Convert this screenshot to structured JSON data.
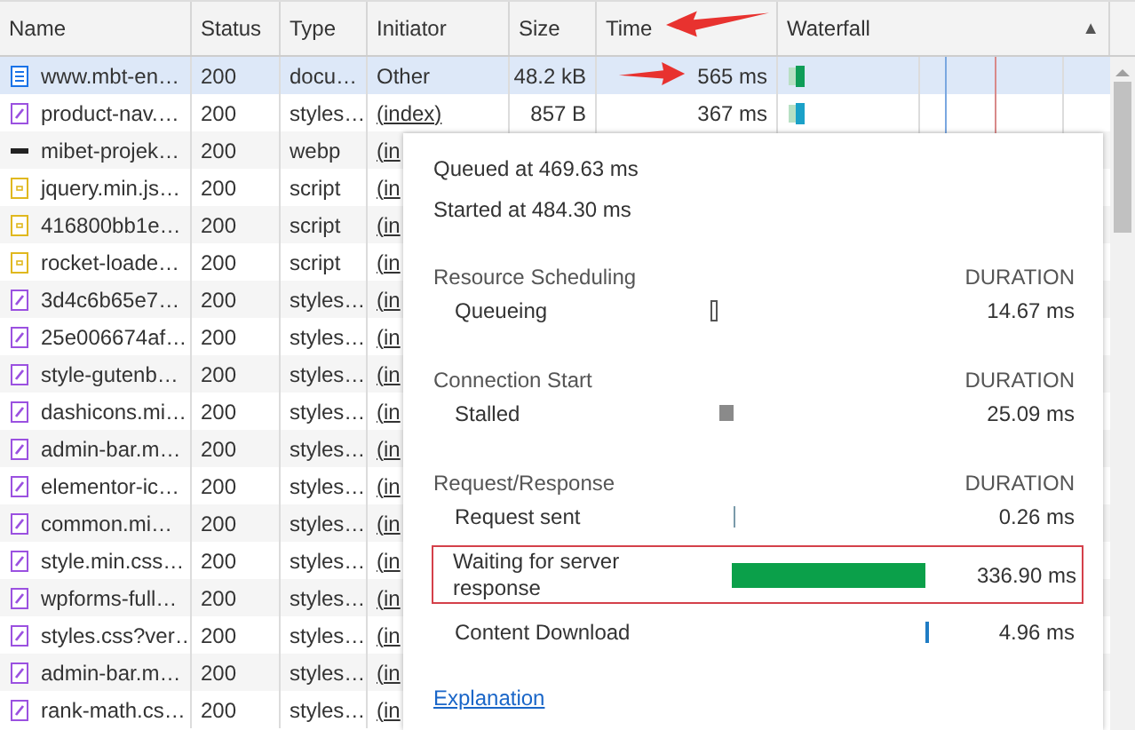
{
  "table": {
    "columns": [
      {
        "label": "Name"
      },
      {
        "label": "Status"
      },
      {
        "label": "Type"
      },
      {
        "label": "Initiator"
      },
      {
        "label": "Size"
      },
      {
        "label": "Time"
      },
      {
        "label": "Waterfall",
        "sort_indicator": "▲"
      }
    ],
    "rows": [
      {
        "kind": "doc",
        "name": "www.mbt-en…",
        "status": "200",
        "type": "docu…",
        "initiator": "Other",
        "initiator_link": false,
        "size": "48.2 kB",
        "time": "565 ms",
        "selected": true
      },
      {
        "kind": "css",
        "name": "product-nav.…",
        "status": "200",
        "type": "styles…",
        "initiator": "(index)",
        "initiator_link": true,
        "size": "857 B",
        "time": "367 ms",
        "selected": false
      },
      {
        "kind": "img",
        "name": "mibet-projek…",
        "status": "200",
        "type": "webp",
        "initiator": "(in",
        "initiator_link": true,
        "selected": false
      },
      {
        "kind": "js",
        "name": "jquery.min.js…",
        "status": "200",
        "type": "script",
        "initiator": "(in",
        "initiator_link": true,
        "selected": false
      },
      {
        "kind": "js",
        "name": "416800bb1e…",
        "status": "200",
        "type": "script",
        "initiator": "(in",
        "initiator_link": true,
        "selected": false
      },
      {
        "kind": "js",
        "name": "rocket-loade…",
        "status": "200",
        "type": "script",
        "initiator": "(in",
        "initiator_link": true,
        "selected": false
      },
      {
        "kind": "css",
        "name": "3d4c6b65e7…",
        "status": "200",
        "type": "styles…",
        "initiator": "(in",
        "initiator_link": true,
        "selected": false
      },
      {
        "kind": "css",
        "name": "25e006674af…",
        "status": "200",
        "type": "styles…",
        "initiator": "(in",
        "initiator_link": true,
        "selected": false
      },
      {
        "kind": "css",
        "name": "style-gutenb…",
        "status": "200",
        "type": "styles…",
        "initiator": "(in",
        "initiator_link": true,
        "selected": false
      },
      {
        "kind": "css",
        "name": "dashicons.mi…",
        "status": "200",
        "type": "styles…",
        "initiator": "(in",
        "initiator_link": true,
        "selected": false
      },
      {
        "kind": "css",
        "name": "admin-bar.m…",
        "status": "200",
        "type": "styles…",
        "initiator": "(in",
        "initiator_link": true,
        "selected": false
      },
      {
        "kind": "css",
        "name": "elementor-ic…",
        "status": "200",
        "type": "styles…",
        "initiator": "(in",
        "initiator_link": true,
        "selected": false
      },
      {
        "kind": "css",
        "name": "common.mi…",
        "status": "200",
        "type": "styles…",
        "initiator": "(in",
        "initiator_link": true,
        "selected": false
      },
      {
        "kind": "css",
        "name": "style.min.css…",
        "status": "200",
        "type": "styles…",
        "initiator": "(in",
        "initiator_link": true,
        "selected": false
      },
      {
        "kind": "css",
        "name": "wpforms-full…",
        "status": "200",
        "type": "styles…",
        "initiator": "(in",
        "initiator_link": true,
        "selected": false
      },
      {
        "kind": "css",
        "name": "styles.css?ver…",
        "status": "200",
        "type": "styles…",
        "initiator": "(in",
        "initiator_link": true,
        "selected": false
      },
      {
        "kind": "css",
        "name": "admin-bar.m…",
        "status": "200",
        "type": "styles…",
        "initiator": "(in",
        "initiator_link": true,
        "selected": false
      },
      {
        "kind": "css",
        "name": "rank-math.cs…",
        "status": "200",
        "type": "styles…",
        "initiator": "(in",
        "initiator_link": true,
        "selected": false
      }
    ]
  },
  "timing_popup": {
    "queued": "Queued at 469.63 ms",
    "started": "Started at 484.30 ms",
    "sections": [
      {
        "title": "Resource Scheduling",
        "duration_heading": "DURATION",
        "phases": [
          {
            "label": "Queueing",
            "kind": "queueing",
            "duration": "14.67 ms",
            "highlighted": false
          }
        ]
      },
      {
        "title": "Connection Start",
        "duration_heading": "DURATION",
        "phases": [
          {
            "label": "Stalled",
            "kind": "stalled",
            "duration": "25.09 ms",
            "highlighted": false
          }
        ]
      },
      {
        "title": "Request/Response",
        "duration_heading": "DURATION",
        "phases": [
          {
            "label": "Request sent",
            "kind": "sent",
            "duration": "0.26 ms",
            "highlighted": false
          },
          {
            "label": "Waiting for server response",
            "kind": "waiting",
            "duration": "336.90 ms",
            "highlighted": true
          },
          {
            "label": "Content Download",
            "kind": "download",
            "duration": "4.96 ms",
            "highlighted": false
          }
        ]
      }
    ],
    "link": "Explanation"
  }
}
